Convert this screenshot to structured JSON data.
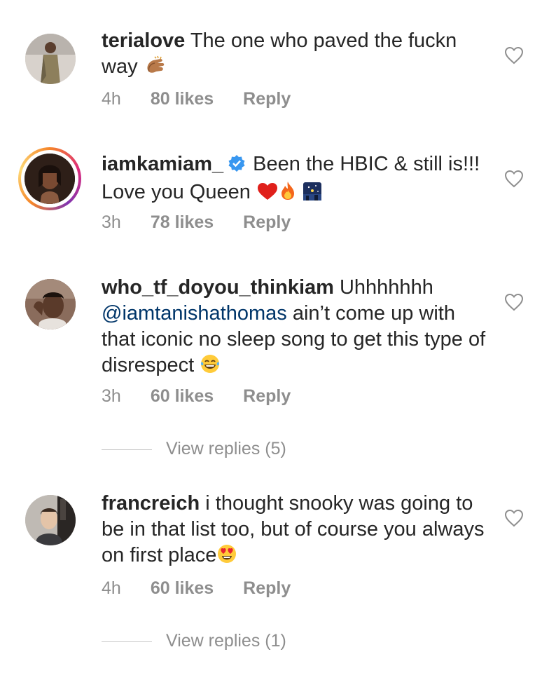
{
  "comments": [
    {
      "username": "terialove",
      "text": " The one who paved the fuckn way ",
      "emoji": "clapping-hands",
      "time": "4h",
      "likes": "80 likes",
      "reply": "Reply"
    },
    {
      "username": "iamkamiam_",
      "verified": true,
      "text": " Been the HBIC & still is!!! Love you Queen ",
      "emojis": [
        "red-heart",
        "fire",
        "night-with-stars"
      ],
      "time": "3h",
      "likes": "78 likes",
      "reply": "Reply"
    },
    {
      "username": "who_tf_doyou_thinkiam",
      "text_before": " Uhhhhhhh ",
      "mention": "@iamtanishathomas",
      "text_after": " ain’t come up with that iconic no sleep song to get this type of disrespect ",
      "emoji": "face-with-tears-of-joy",
      "time": "3h",
      "likes": "60 likes",
      "reply": "Reply",
      "view_replies": "View replies (5)"
    },
    {
      "username": "francreich",
      "text": " i thought snooky was going to be in that list too, but of course you always on first place",
      "emoji": "heart-eyes",
      "time": "4h",
      "likes": "60 likes",
      "reply": "Reply",
      "view_replies": "View replies (1)"
    }
  ],
  "colors": {
    "text": "#262626",
    "secondary": "#8e8e8e",
    "mention": "#003569",
    "verified": "#3897f0"
  }
}
